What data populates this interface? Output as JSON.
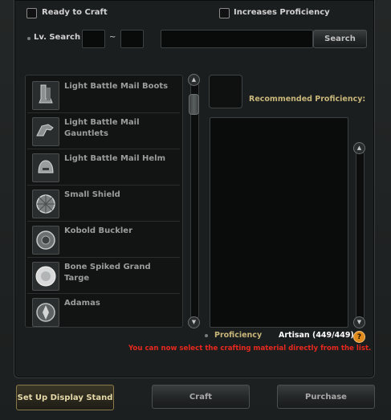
{
  "filters": {
    "ready_to_craft": "Ready to Craft",
    "increases_proficiency": "Increases Proficiency",
    "lv_search_label": "Lv. Search",
    "range_separator": "~",
    "level_min": "",
    "level_max": "",
    "search_text": "",
    "search_button": "Search"
  },
  "items": [
    {
      "name": "Light Battle Mail Boots",
      "icon": "boots-icon"
    },
    {
      "name": "Light Battle Mail Gauntlets",
      "icon": "gauntlets-icon"
    },
    {
      "name": "Light Battle Mail Helm",
      "icon": "helm-icon"
    },
    {
      "name": "Small Shield",
      "icon": "small-shield-icon"
    },
    {
      "name": "Kobold Buckler",
      "icon": "buckler-icon"
    },
    {
      "name": "Bone Spiked Grand Targe",
      "icon": "targe-icon"
    },
    {
      "name": "Adamas",
      "icon": "adamas-icon"
    }
  ],
  "detail": {
    "recommended_label": "Recommended Proficiency:",
    "proficiency_label": "Proficiency",
    "proficiency_value": "Artisan (449/449)",
    "notice": "You can now select the crafting material directly from the list.",
    "help_icon_glyph": "?"
  },
  "scroll_glyphs": {
    "up": "▲",
    "down": "▼"
  },
  "buttons": {
    "display_stand": "Set Up Display Stand",
    "craft": "Craft",
    "purchase": "Purchase"
  },
  "colors": {
    "notice": "#e8281e",
    "label_gold": "#c8b67a",
    "help_orange": "#e08a1c"
  }
}
